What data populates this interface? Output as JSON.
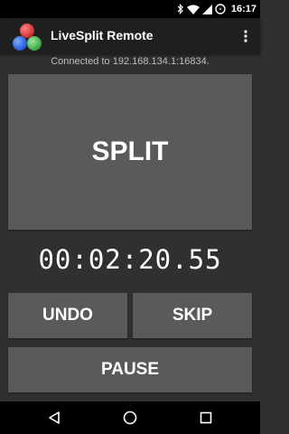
{
  "status_bar": {
    "time": "16:17",
    "icons": [
      "bluetooth-icon",
      "wifi-icon",
      "signal-icon",
      "battery-icon"
    ]
  },
  "app_bar": {
    "title": "LiveSplit Remote",
    "logo_icon": "livesplit-logo",
    "menu_icon": "overflow-menu-icon"
  },
  "connection": {
    "status": "Connected to 192.168.134.1:16834."
  },
  "controls": {
    "split_label": "SPLIT",
    "timer": "00:02:20.55",
    "undo_label": "UNDO",
    "skip_label": "SKIP",
    "pause_label": "PAUSE"
  },
  "nav_bar": {
    "icons": [
      "back-icon",
      "home-icon",
      "recents-icon"
    ]
  },
  "colors": {
    "background": "#303030",
    "app_bar": "#1f1f1f",
    "button": "#5a5a5a",
    "text": "#ffffff"
  }
}
